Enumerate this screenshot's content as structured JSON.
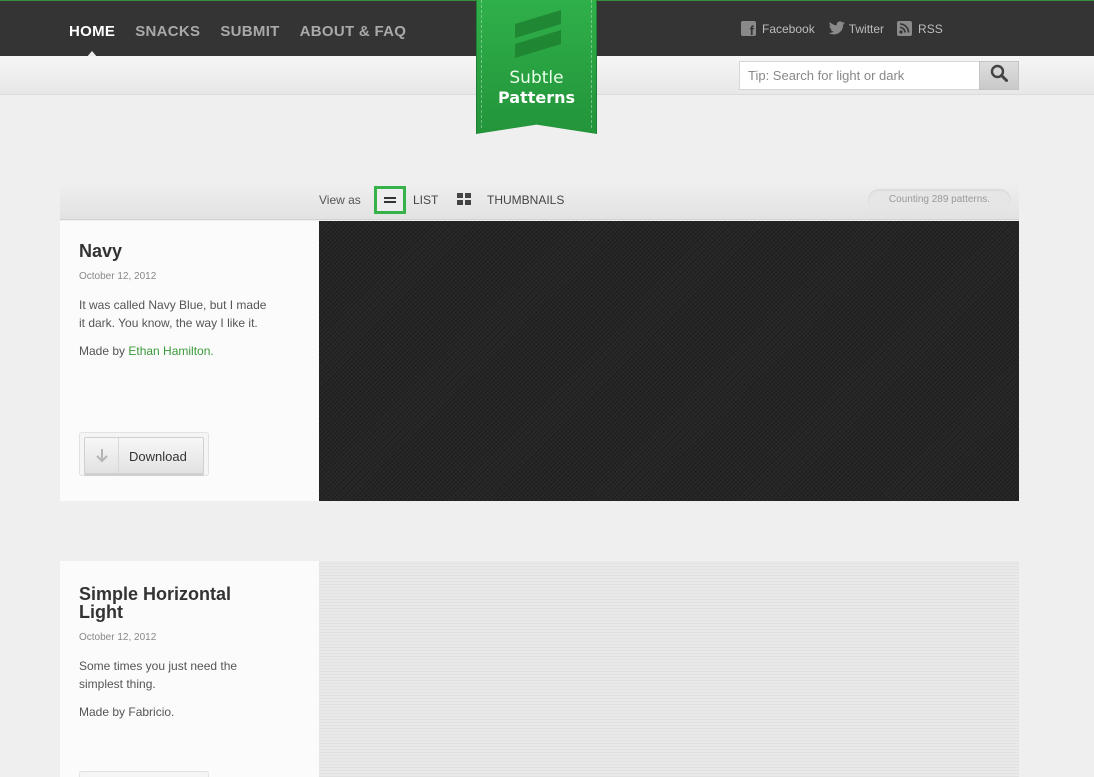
{
  "nav": {
    "items": [
      {
        "label": "HOME",
        "active": true
      },
      {
        "label": "SNACKS",
        "active": false
      },
      {
        "label": "SUBMIT",
        "active": false
      },
      {
        "label": "ABOUT & FAQ",
        "active": false
      }
    ]
  },
  "logo": {
    "line1": "Subtle",
    "line2": "Patterns"
  },
  "social": {
    "facebook": "Facebook",
    "twitter": "Twitter",
    "rss": "RSS"
  },
  "search": {
    "placeholder": "Tip: Search for light or dark",
    "value": ""
  },
  "viewbar": {
    "view_as": "View as",
    "list": "LIST",
    "thumbnails": "THUMBNAILS",
    "count": "Counting 289 patterns."
  },
  "patterns": [
    {
      "title": "Navy",
      "date": "October 12, 2012",
      "description": "It was called Navy Blue, but I made it dark. You know, the way I like it.",
      "made_by_prefix": "Made by ",
      "author": "Ethan Hamilton.",
      "author_is_link": true,
      "download": "Download"
    },
    {
      "title": "Simple Horizontal Light",
      "date": "October 12, 2012",
      "description": "Some times you just need the simplest thing.",
      "made_by_prefix": "Made by ",
      "author": "Fabricio.",
      "author_is_link": false
    }
  ],
  "colors": {
    "accent": "#35b24a",
    "topbar": "#343434",
    "link": "#3a9a3a"
  }
}
